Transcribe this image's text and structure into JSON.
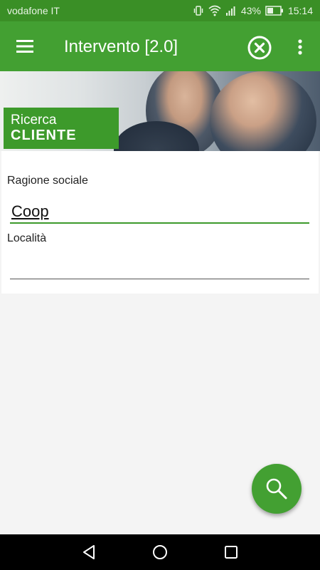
{
  "status_bar": {
    "carrier": "vodafone IT",
    "battery": "43%",
    "time": "15:14",
    "icons": [
      "vibrate-icon",
      "wifi-icon",
      "signal-icon",
      "battery-icon"
    ]
  },
  "app_bar": {
    "title": "Intervento [2.0]",
    "icons": [
      "menu-icon",
      "close-circle-icon",
      "more-vert-icon"
    ]
  },
  "banner": {
    "line1": "Ricerca",
    "line2": "CLIENTE"
  },
  "form": {
    "ragione_sociale": {
      "label": "Ragione sociale",
      "value": "Coop"
    },
    "localita": {
      "label": "Località",
      "value": ""
    }
  },
  "fab": {
    "icon": "search-icon"
  },
  "nav_bar": {
    "icons": [
      "back-icon",
      "home-icon",
      "recents-icon"
    ]
  },
  "colors": {
    "primary": "#43a032",
    "primary_dark": "#3a8f26",
    "accent_line": "#3d9a2b"
  }
}
